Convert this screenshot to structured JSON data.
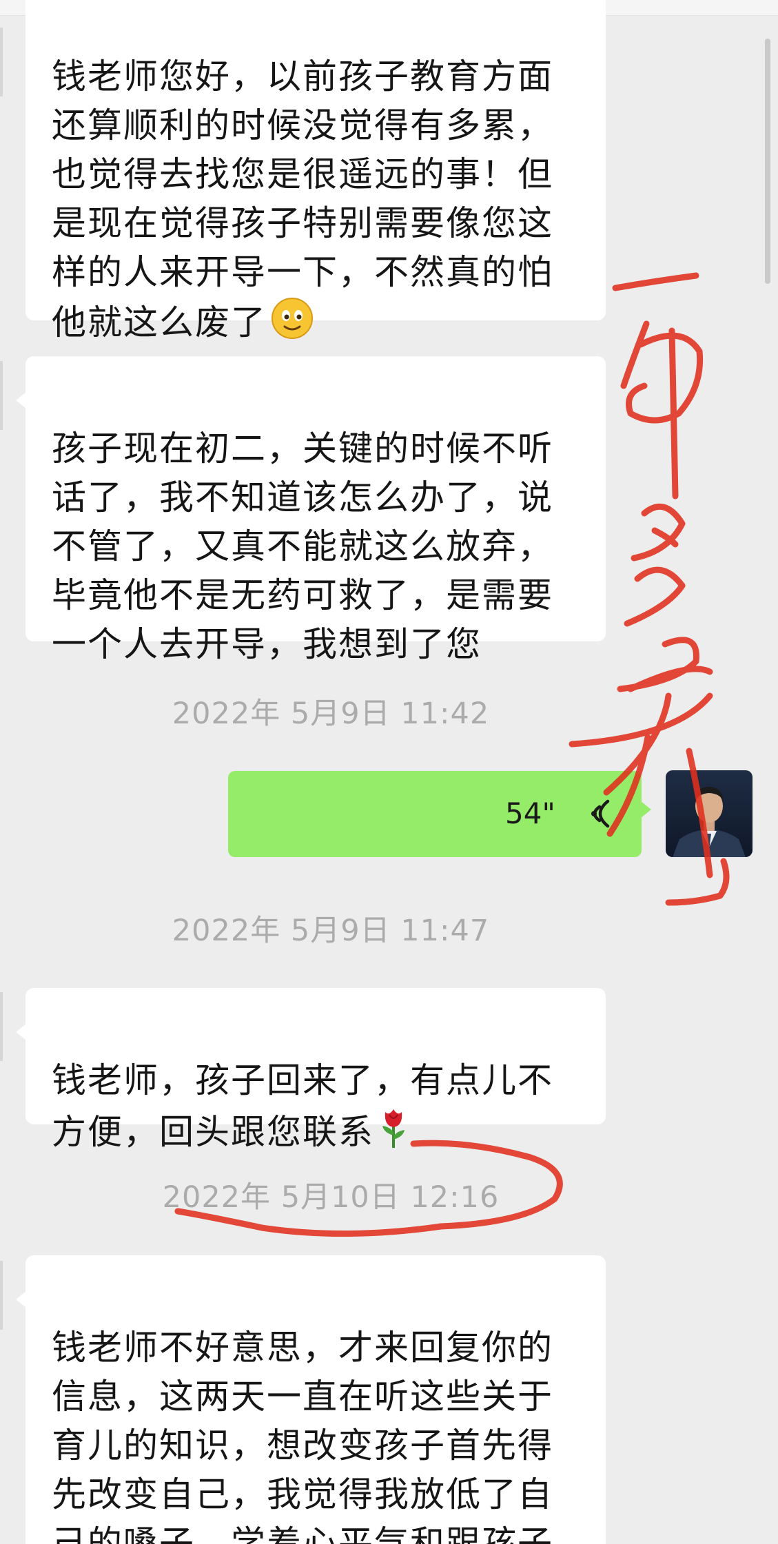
{
  "messages": [
    {
      "text": "钱老师您好，以前孩子教育方面\n还算顺利的时候没觉得有多累，\n也觉得去找您是很遥远的事！但\n是现在觉得孩子特别需要像您这\n样的人来开导一下，不然真的怕\n他就这么废了",
      "emoji": "smiley-face-icon"
    },
    {
      "text": "孩子现在初二，关键的时候不听\n话了，我不知道该怎么办了，说\n不管了，又真不能就这么放弃，\n毕竟他不是无药可救了，是需要\n一个人去开导，我想到了您"
    },
    {
      "timestamp": "2022年 5月9日 11:42"
    },
    {
      "voice_duration": "54\"",
      "icon": "voice-wave-icon",
      "avatar": "avatar-photo"
    },
    {
      "timestamp": "2022年 5月9日 11:47"
    },
    {
      "text": "钱老师，孩子回来了，有点儿不\n方便，回头跟您联系",
      "emoji": "rose-icon"
    },
    {
      "timestamp": "2022年 5月10日 12:16"
    },
    {
      "text": "钱老师不好意思，才来回复你的\n信息，这两天一直在听这些关于\n育儿的知识，想改变孩子首先得\n先改变自己，我觉得我放低了自\n己的嗓子，学着心平气和跟孩子\n说话，感觉非常好，孩子这两天"
    }
  ],
  "colors": {
    "background": "#ededed",
    "incoming_bubble": "#ffffff",
    "outgoing_bubble": "#95ec69",
    "timestamp_text": "#ababab",
    "annotation_red": "#e0301e"
  },
  "handwritten_annotation": "一年多前"
}
